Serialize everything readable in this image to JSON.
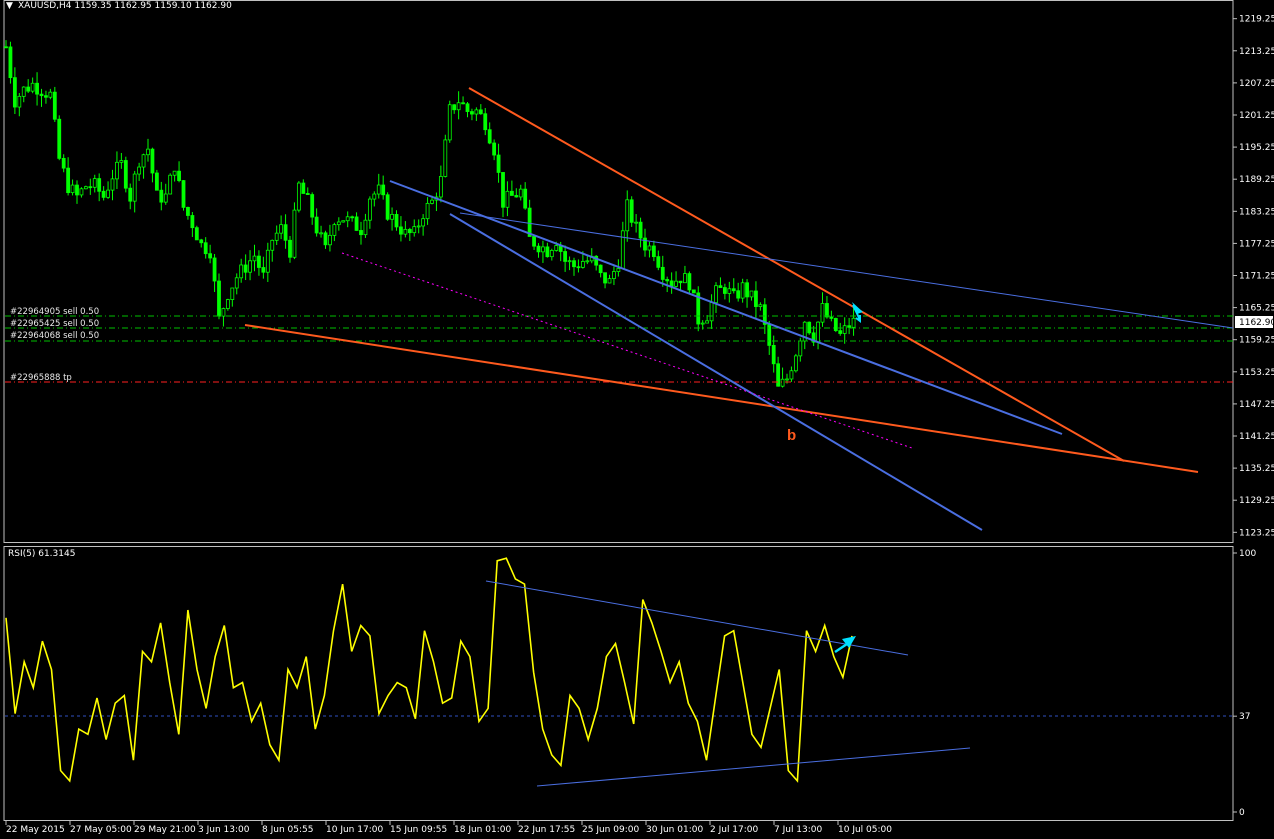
{
  "header": {
    "symbol_line": "XAUUSD,H4  1159.35 1162.95 1159.10 1162.90",
    "rsi_label": "RSI(5) 61.3145"
  },
  "colors": {
    "background": "#000000",
    "frame": "#c0c0c0",
    "bull_candle": "#00ff00",
    "bear_candle": "#00ff00",
    "rsi_line": "#ffff00",
    "trendline_red": "#ff5a1e",
    "trendline_blue": "#4a6ee0",
    "order_line": "#00c000",
    "tp_line": "#ff2020",
    "dotted_magenta": "#ff00ff",
    "arrow": "#00e0ff",
    "price_tag_bg": "#ffffff"
  },
  "annotations": {
    "wave_label": "b",
    "orders": [
      "#22964905 sell 0.50",
      "#22965425 sell 0.50",
      "#22964068 sell 0.50"
    ],
    "tp_label": "#22965888 tp"
  },
  "current_price": "1162.90",
  "chart_data": [
    {
      "type": "candlestick",
      "title": "XAUUSD,H4",
      "y_ticks": [
        "1219.25",
        "1213.25",
        "1207.25",
        "1201.25",
        "1195.25",
        "1189.25",
        "1183.25",
        "1177.25",
        "1171.25",
        "1165.25",
        "1159.25",
        "1153.25",
        "1147.25",
        "1141.25",
        "1135.25",
        "1129.25",
        "1123.25"
      ],
      "ylim": [
        1122.0,
        1220.5
      ],
      "x_tick_labels": [
        "22 May 2015",
        "27 May 05:00",
        "29 May 21:00",
        "3 Jun 13:00",
        "8 Jun 05:55",
        "10 Jun 17:00",
        "15 Jun 09:55",
        "18 Jun 01:00",
        "22 Jun 17:55",
        "25 Jun 09:00",
        "30 Jun 01:00",
        "2 Jul 17:00",
        "7 Jul 13:00",
        "10 Jul 05:00"
      ],
      "close_path": [
        [
          0,
          1214
        ],
        [
          2,
          1204
        ],
        [
          4,
          1206
        ],
        [
          6,
          1207
        ],
        [
          8,
          1206
        ],
        [
          10,
          1205
        ],
        [
          12,
          1193
        ],
        [
          14,
          1188
        ],
        [
          16,
          1186
        ],
        [
          18,
          1188
        ],
        [
          20,
          1188
        ],
        [
          22,
          1186
        ],
        [
          24,
          1190
        ],
        [
          26,
          1192
        ],
        [
          28,
          1186
        ],
        [
          30,
          1193
        ],
        [
          32,
          1195
        ],
        [
          34,
          1186
        ],
        [
          36,
          1186
        ],
        [
          38,
          1192
        ],
        [
          40,
          1184
        ],
        [
          42,
          1181
        ],
        [
          44,
          1177
        ],
        [
          46,
          1176
        ],
        [
          48,
          1163
        ],
        [
          50,
          1168
        ],
        [
          52,
          1171
        ],
        [
          54,
          1173
        ],
        [
          56,
          1175
        ],
        [
          58,
          1171
        ],
        [
          60,
          1178
        ],
        [
          62,
          1180
        ],
        [
          64,
          1176
        ],
        [
          66,
          1188
        ],
        [
          68,
          1185
        ],
        [
          70,
          1180
        ],
        [
          72,
          1176
        ],
        [
          74,
          1182
        ],
        [
          76,
          1182
        ],
        [
          78,
          1181
        ],
        [
          80,
          1180
        ],
        [
          82,
          1186
        ],
        [
          84,
          1187
        ],
        [
          86,
          1183
        ],
        [
          88,
          1181
        ],
        [
          90,
          1179
        ],
        [
          92,
          1179
        ],
        [
          94,
          1183
        ],
        [
          96,
          1185
        ],
        [
          98,
          1189
        ],
        [
          100,
          1202
        ],
        [
          102,
          1204
        ],
        [
          104,
          1202
        ],
        [
          106,
          1202
        ],
        [
          108,
          1200
        ],
        [
          110,
          1195
        ],
        [
          112,
          1185
        ],
        [
          114,
          1186
        ],
        [
          116,
          1187
        ],
        [
          118,
          1178
        ],
        [
          120,
          1177
        ],
        [
          122,
          1176
        ],
        [
          124,
          1178
        ],
        [
          126,
          1174
        ],
        [
          128,
          1173
        ],
        [
          130,
          1174
        ],
        [
          132,
          1174
        ],
        [
          134,
          1171
        ],
        [
          136,
          1170
        ],
        [
          138,
          1174
        ],
        [
          140,
          1184
        ],
        [
          142,
          1180
        ],
        [
          144,
          1177
        ],
        [
          146,
          1176
        ],
        [
          148,
          1172
        ],
        [
          150,
          1170
        ],
        [
          152,
          1171
        ],
        [
          154,
          1170
        ],
        [
          156,
          1163
        ],
        [
          158,
          1164
        ],
        [
          160,
          1168
        ],
        [
          162,
          1169
        ],
        [
          164,
          1167
        ],
        [
          166,
          1169
        ],
        [
          168,
          1167
        ],
        [
          170,
          1165
        ],
        [
          172,
          1158
        ],
        [
          174,
          1150
        ],
        [
          176,
          1152
        ],
        [
          178,
          1157
        ],
        [
          180,
          1163
        ],
        [
          182,
          1160
        ],
        [
          184,
          1165
        ],
        [
          186,
          1162
        ],
        [
          188,
          1160
        ],
        [
          190,
          1162
        ],
        [
          192,
          1163
        ]
      ]
    },
    {
      "type": "line",
      "title": "RSI(5)",
      "value_label": "61.3145",
      "y_ticks": [
        "100",
        "37",
        "0"
      ],
      "ylim": [
        0,
        100
      ],
      "level": 37,
      "values": [
        75,
        38,
        58,
        48,
        66,
        55,
        16,
        12,
        32,
        30,
        44,
        28,
        42,
        45,
        20,
        62,
        58,
        73,
        50,
        30,
        78,
        55,
        40,
        60,
        72,
        48,
        50,
        35,
        42,
        26,
        20,
        55,
        48,
        60,
        32,
        45,
        70,
        88,
        62,
        72,
        68,
        38,
        45,
        50,
        48,
        36,
        70,
        58,
        42,
        44,
        66,
        60,
        35,
        40,
        97,
        98,
        90,
        88,
        54,
        32,
        22,
        18,
        45,
        40,
        28,
        40,
        60,
        65,
        50,
        34,
        82,
        73,
        62,
        50,
        58,
        42,
        35,
        20,
        44,
        68,
        70,
        50,
        30,
        25,
        40,
        55,
        16,
        12,
        70,
        62,
        72,
        60,
        52,
        68
      ]
    }
  ]
}
